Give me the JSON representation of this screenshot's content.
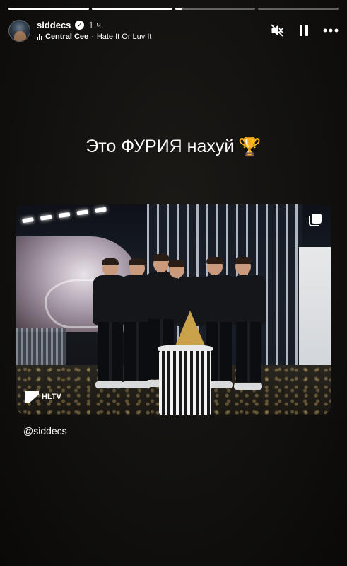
{
  "progress": [
    1,
    1,
    0.08,
    0
  ],
  "header": {
    "username": "siddecs",
    "time": "1 ч.",
    "music_artist": "Central Cee",
    "music_separator": " · ",
    "music_track": "Hate It Or Luv It",
    "icons": [
      "verified-icon",
      "music-bars-icon",
      "mute-icon",
      "pause-icon",
      "more-icon"
    ]
  },
  "caption": {
    "text": "Это ФУРИЯ нахуй",
    "emoji": "🏆"
  },
  "photo": {
    "watermark": "HLTV",
    "icons": [
      "multiple-images-icon"
    ]
  },
  "mention": "@siddecs"
}
